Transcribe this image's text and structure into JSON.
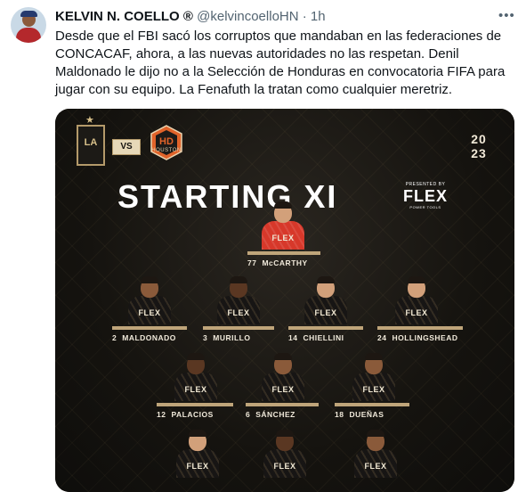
{
  "tweet": {
    "author_name": "KELVIN N. COELLO",
    "badge": "®",
    "handle": "@kelvincoelloHN",
    "separator": "·",
    "time": "1h",
    "more_icon": "ellipsis-icon",
    "text": "Desde que el FBI sacó los corruptos que mandaban en las federaciones de CONCACAF, ahora, a las nuevas autoridades no las respetan. Denil Maldonado le dijo no a la Selección de Honduras en convocatoria FIFA para jugar con su equipo. La Fenafuth la tratan como cualquier meretriz."
  },
  "graphic": {
    "home_logo_text": "LA",
    "vs": "VS",
    "away_logo_text": "HOUSTON",
    "year_top": "20",
    "year_bottom": "23",
    "title": "STARTING XI",
    "presented_by": "PRESENTED BY",
    "sponsor": "FLEX",
    "sponsor_sub": "POWER TOOLS",
    "jersey_text": "FLEX",
    "players": [
      {
        "number": "77",
        "name": "McCARTHY"
      },
      {
        "number": "2",
        "name": "MALDONADO"
      },
      {
        "number": "3",
        "name": "MURILLO"
      },
      {
        "number": "14",
        "name": "CHIELLINI"
      },
      {
        "number": "24",
        "name": "HOLLINGSHEAD"
      },
      {
        "number": "12",
        "name": "PALACIOS"
      },
      {
        "number": "6",
        "name": "SÁNCHEZ"
      },
      {
        "number": "18",
        "name": "DUEÑAS"
      }
    ]
  }
}
